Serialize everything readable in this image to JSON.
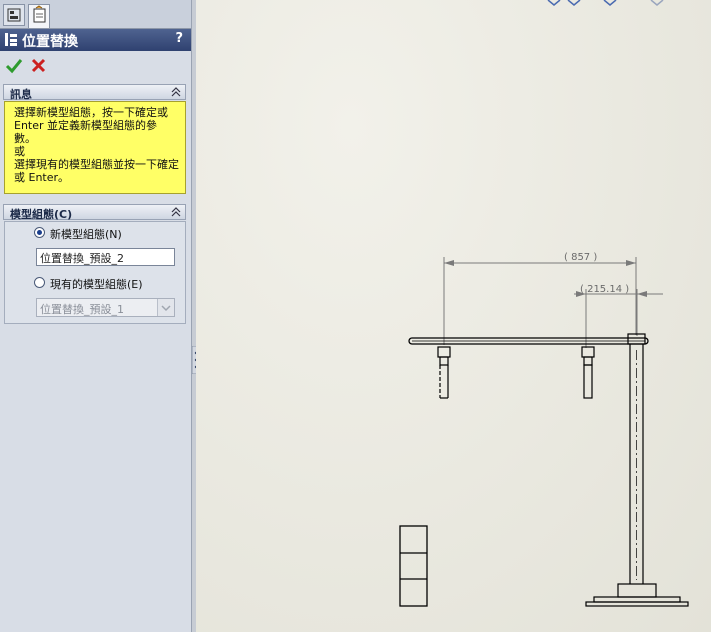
{
  "panel": {
    "title": "位置替換",
    "help": "?",
    "message_group": {
      "title": "訊息",
      "text": "選擇新模型組態，按一下確定或 Enter 並定義新模型組態的參數。\n或\n選擇現有的模型組態並按一下確定或 Enter。"
    },
    "config_group": {
      "title": "模型組態(C)",
      "new_option_label": "新模型組態(N)",
      "new_name_value": "位置替換_預設_2",
      "existing_option_label": "現有的模型組態(E)",
      "existing_selected": "位置替換_預設_1"
    }
  },
  "drawing": {
    "dimensions": [
      {
        "label": "( 857 )"
      },
      {
        "label": "( 215.14 )"
      }
    ]
  },
  "colors": {
    "ok": "#2e9b2e",
    "cancel": "#cc2020",
    "message_bg": "#ffff66",
    "title_bar": "#2f4170"
  },
  "icons": [
    "feature-manager-tab-icon",
    "property-manager-tab-icon",
    "position-override-icon",
    "help-icon",
    "ok-checkmark-icon",
    "cancel-x-icon",
    "collapse-chevron-icon"
  ]
}
